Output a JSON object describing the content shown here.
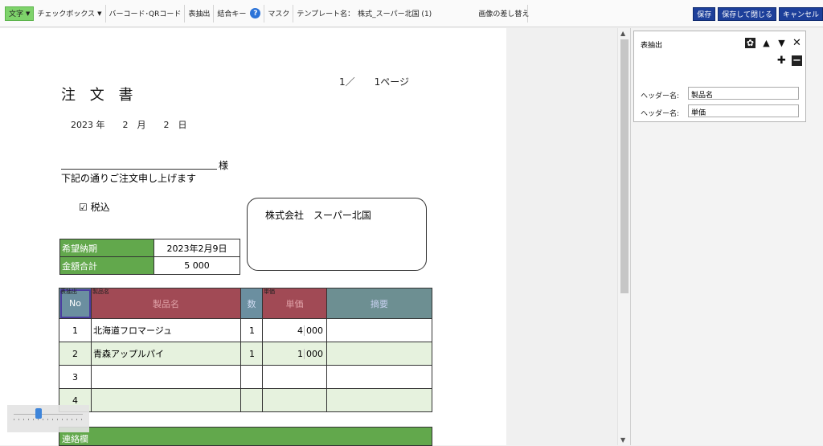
{
  "toolbar": {
    "text_label": "文字",
    "checkbox_label": "チェックボックス",
    "barcode_label": "バーコード･QRコード",
    "table_extract_label": "表抽出",
    "join_key_label": "結合キー",
    "mask_label": "マスク",
    "template_name_label": "テンプレート名：",
    "template_name_value": "株式_スーパー北国 (1)",
    "replace_image_label": "画像の差し替え",
    "save_label": "保存",
    "save_close_label": "保存して閉じる",
    "cancel_label": "キャンセル",
    "help_glyph": "?",
    "dropdown_icon": "chevron-down-icon"
  },
  "document": {
    "title": "注 文 書",
    "page_indicator": "1／　　1ページ",
    "date": "2023 年　　2　月　　2　日",
    "sama": "様",
    "greeting": "下記の通りご注文申し上げます",
    "tax_included": "☑ 税込",
    "company": "株式会社　スーパー北国",
    "delivery_label": "希望納期",
    "delivery_value": "2023年2月9日",
    "total_label": "金額合計",
    "total_value": "5 000",
    "table": {
      "tag_no": "表抽出",
      "tag_name": "製品名",
      "tag_price": "単価",
      "headers": [
        "No",
        "製品名",
        "数",
        "単価",
        "摘要"
      ],
      "rows": [
        {
          "no": "1",
          "name": "北海道フロマージュ",
          "qty": "1",
          "price_a": "4",
          "price_b": "000"
        },
        {
          "no": "2",
          "name": "青森アップルパイ",
          "qty": "1",
          "price_a": "1",
          "price_b": "000"
        },
        {
          "no": "3",
          "name": "",
          "qty": "",
          "price_a": "",
          "price_b": ""
        },
        {
          "no": "4",
          "name": "",
          "qty": "",
          "price_a": "",
          "price_b": ""
        }
      ]
    },
    "contact_label": "連絡欄"
  },
  "panel": {
    "title": "表抽出",
    "header_label_1": "ヘッダー名:",
    "header_value_1": "製品名",
    "header_label_2": "ヘッダー名:",
    "header_value_2": "単価",
    "settings_icon": "gear-icon",
    "up_icon": "triangle-up-icon",
    "down_icon": "triangle-down-icon",
    "close_icon": "close-icon",
    "add_icon": "plus-icon",
    "remove_icon": "minus-icon"
  },
  "zoom_slider": {
    "value_fraction": 0.35
  }
}
